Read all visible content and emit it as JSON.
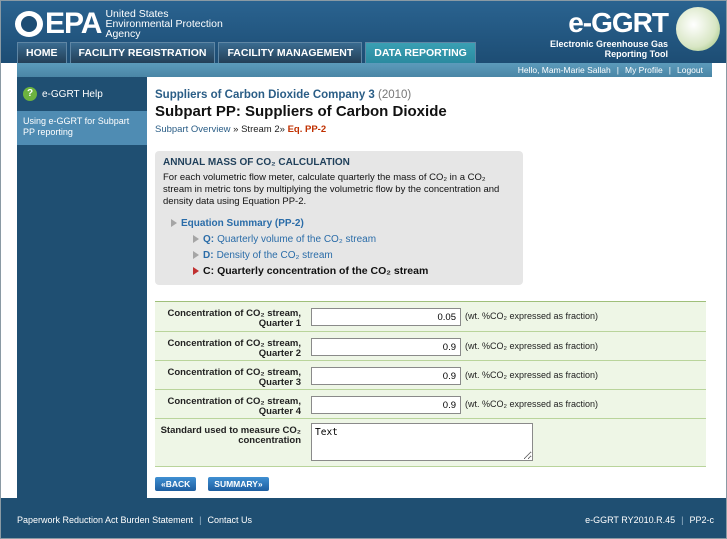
{
  "header": {
    "epa": "EPA",
    "agency_l1": "United States",
    "agency_l2": "Environmental Protection",
    "agency_l3": "Agency",
    "brand": "e-GGRT",
    "brand_sub1": "Electronic Greenhouse Gas",
    "brand_sub2": "Reporting Tool"
  },
  "nav": {
    "tabs": [
      "HOME",
      "FACILITY REGISTRATION",
      "FACILITY MANAGEMENT",
      "DATA REPORTING"
    ]
  },
  "userbar": {
    "greeting": "Hello, Mam-Marie Sallah",
    "profile": "My Profile",
    "logout": "Logout",
    "sep": "|"
  },
  "sidebar": {
    "help": "e-GGRT Help",
    "link": "Using e-GGRT for Subpart PP reporting"
  },
  "main": {
    "supplier": "Suppliers of Carbon Dioxide Company 3",
    "year": "(2010)",
    "subpart": "Subpart PP: Suppliers of Carbon Dioxide",
    "crumb_overview": "Subpart Overview",
    "crumb_sep": "»",
    "crumb_stream": "Stream 2",
    "crumb_current": "Eq. PP-2",
    "calc_title": "ANNUAL MASS OF CO₂ CALCULATION",
    "calc_desc": "For each volumetric flow meter, calculate quarterly the mass of CO₂ in a CO₂ stream in metric tons by multiplying the volumetric flow by the concentration and density data using Equation PP-2.",
    "tree_root": "Equation Summary (PP-2)",
    "tree_q_code": "Q:",
    "tree_q_label": "Quarterly volume of the CO₂ stream",
    "tree_d_code": "D:",
    "tree_d_label": "Density of the CO₂ stream",
    "tree_c_code": "C:",
    "tree_c_label": "Quarterly concentration of the CO₂ stream"
  },
  "form": {
    "rows": [
      {
        "label1": "Concentration of CO₂ stream,",
        "label2": "Quarter 1",
        "value": "0.05",
        "unit": "(wt. %CO₂ expressed as fraction)"
      },
      {
        "label1": "Concentration of CO₂ stream,",
        "label2": "Quarter 2",
        "value": "0.9",
        "unit": "(wt. %CO₂ expressed as fraction)"
      },
      {
        "label1": "Concentration of CO₂ stream,",
        "label2": "Quarter 3",
        "value": "0.9",
        "unit": "(wt. %CO₂ expressed as fraction)"
      },
      {
        "label1": "Concentration of CO₂ stream,",
        "label2": "Quarter 4",
        "value": "0.9",
        "unit": "(wt. %CO₂ expressed as fraction)"
      }
    ],
    "standard_label1": "Standard used to measure CO₂",
    "standard_label2": "concentration",
    "standard_value": "Text"
  },
  "buttons": {
    "back": "«BACK",
    "summary": "SUMMARY»"
  },
  "footer": {
    "paperwork": "Paperwork Reduction Act Burden Statement",
    "contact": "Contact Us",
    "version": "e-GGRT RY2010.R.45",
    "page_id": "PP2-c",
    "sep": "|"
  },
  "colors": {
    "header": "#1d4d74",
    "accent_tab": "#2a8aa0",
    "link": "#2a5d86",
    "current_crumb": "#c03000",
    "form_bg": "#eef6e6"
  }
}
